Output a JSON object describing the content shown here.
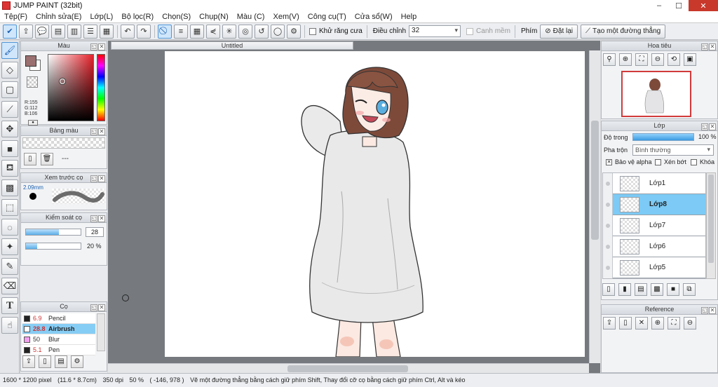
{
  "window": {
    "title": "JUMP PAINT (32bit)",
    "min": "–",
    "max": "☐",
    "close": "✕"
  },
  "menu": [
    "Tệp(F)",
    "Chỉnh sửa(E)",
    "Lớp(L)",
    "Bộ lọc(R)",
    "Chọn(S)",
    "Chụp(N)",
    "Màu (C)",
    "Xem(V)",
    "Công cụ(T)",
    "Cửa sổ(W)",
    "Help"
  ],
  "toolbar": {
    "antialias_label": "Khử răng cưa",
    "adjust_label": "Điều chỉnh",
    "adjust_value": "32",
    "smooth_label": "Canh mềm",
    "key_label": "Phím",
    "reset_label": "Đặt lại",
    "straight_line_label": "Tạo một đường thẳng"
  },
  "panels": {
    "color": {
      "title": "Màu",
      "r": "R:155",
      "g": "G:112",
      "b": "B:106",
      "fg_color": "#9b7070"
    },
    "palette": {
      "title": "Bảng màu",
      "text": "---"
    },
    "brush_preview": {
      "title": "Xem trước cọ",
      "size": "2.09mm"
    },
    "brush_control": {
      "title": "Kiểm soát cọ",
      "size_value": "28",
      "size_fraction": 0.6,
      "opacity_value": "20 %",
      "opacity_fraction": 0.2
    },
    "brushes": {
      "title": "Cọ",
      "items": [
        {
          "size": "6.9",
          "name": "Pencil",
          "swatch": "#222222",
          "selected": false
        },
        {
          "size": "28.8",
          "name": "Airbrush",
          "swatch": "#ffffff",
          "selected": true
        },
        {
          "size": "50",
          "name": "Blur",
          "swatch": "#f2a0f0",
          "selected": false
        },
        {
          "size": "5.1",
          "name": "Pen",
          "swatch": "#222222",
          "selected": false
        }
      ]
    },
    "navigator": {
      "title": "Hoa tiêu"
    },
    "layers": {
      "title": "Lớp",
      "opacity_label": "Độ trong",
      "opacity_value": "100 %",
      "blend_label": "Pha trộn",
      "blend_value": "Bình thường",
      "alpha_label": "Bảo vệ alpha",
      "clip_label": "Xén bớt",
      "lock_label": "Khóa",
      "alpha_check": "✕",
      "items": [
        {
          "name": "Lớp1",
          "selected": false
        },
        {
          "name": "Lớp8",
          "selected": true
        },
        {
          "name": "Lớp7",
          "selected": false
        },
        {
          "name": "Lớp6",
          "selected": false
        },
        {
          "name": "Lớp5",
          "selected": false
        }
      ]
    },
    "reference": {
      "title": "Reference"
    }
  },
  "document": {
    "tab": "Untitled"
  },
  "status": {
    "size": "1600 * 1200 pixel",
    "physical": "(11.6 * 8.7cm)",
    "dpi": "350 dpi",
    "zoom": "50 %",
    "coords": "( -146, 978 )",
    "hint": "Vẽ một đường thẳng bằng cách giữ phím Shift, Thay đổi cỡ cọ bằng cách giữ phím Ctrl, Alt và kéo"
  }
}
